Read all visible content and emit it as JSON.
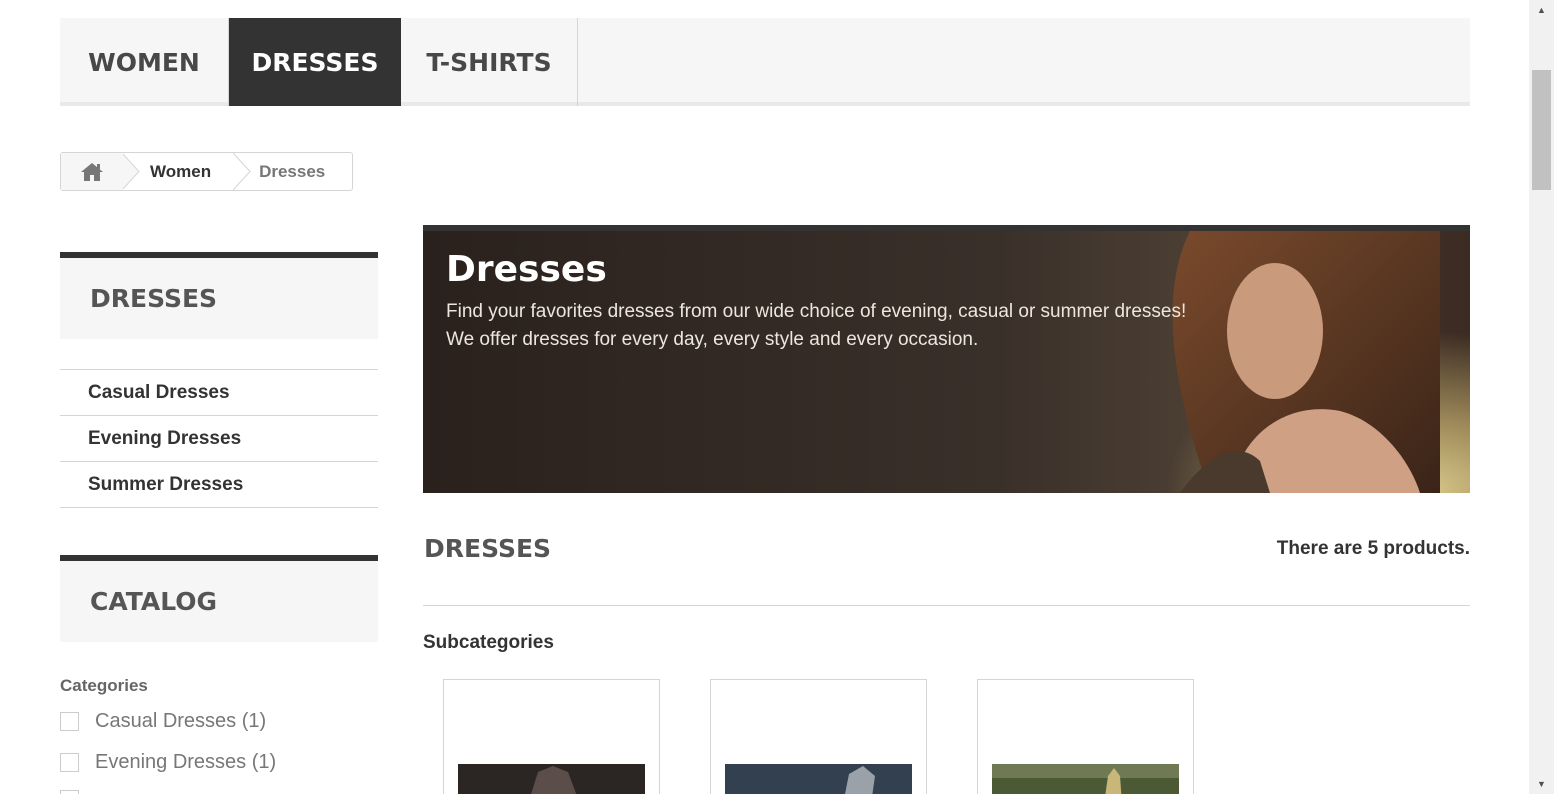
{
  "menu": {
    "tabs": [
      {
        "label": "WOMEN"
      },
      {
        "label": "DRESSES"
      },
      {
        "label": "T-SHIRTS"
      }
    ],
    "active": "DRESSES"
  },
  "breadcrumb": {
    "home_icon": "home-icon",
    "items": [
      "Women",
      "Dresses"
    ]
  },
  "sidebar": {
    "category_block_title": "DRESSES",
    "categories": [
      "Casual Dresses",
      "Evening Dresses",
      "Summer Dresses"
    ],
    "catalog_title": "CATALOG",
    "filter_label": "Categories",
    "filters": [
      "Casual Dresses (1)",
      "Evening Dresses (1)"
    ]
  },
  "banner": {
    "title": "Dresses",
    "line1": "Find your favorites dresses from our wide choice of evening, casual or summer dresses!",
    "line2": "We offer dresses for every day, every style and every occasion."
  },
  "main": {
    "heading": "DRESSES",
    "product_count": "There are 5 products.",
    "subcategories_title": "Subcategories"
  },
  "colors": {
    "dark": "#333333",
    "panel": "#f6f6f6",
    "border": "#d6d4d4"
  }
}
